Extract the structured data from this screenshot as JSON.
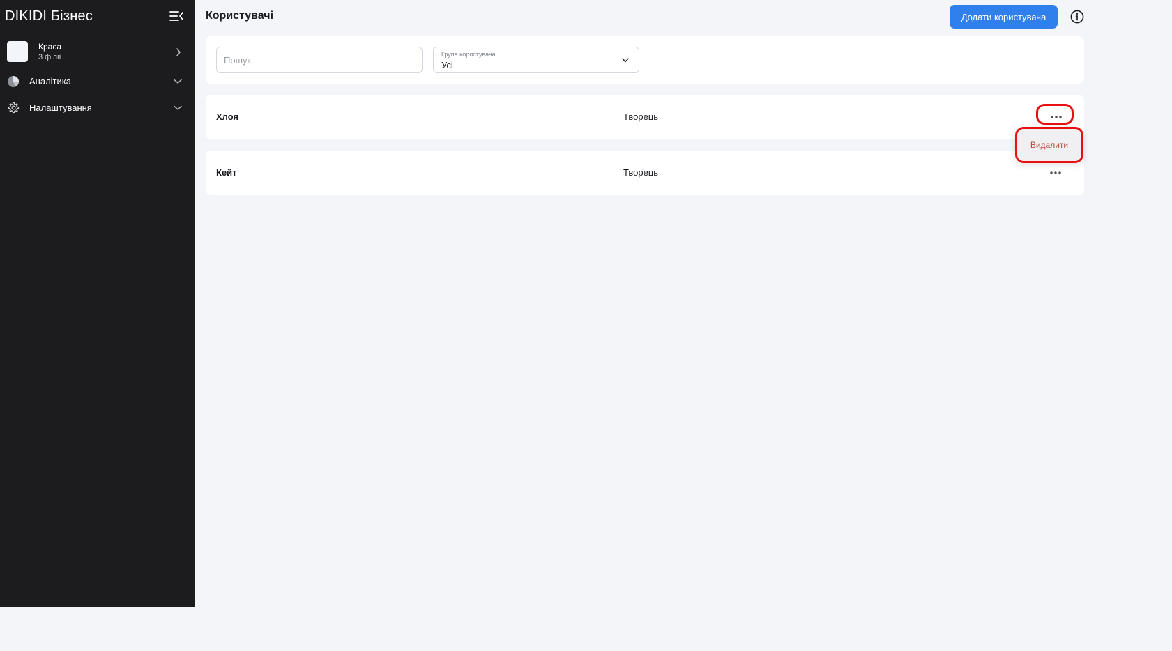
{
  "sidebar": {
    "brand": "DIKIDI Бізнес",
    "branch": {
      "name": "Краса",
      "subtitle": "3 філії"
    },
    "items": [
      {
        "label": "Аналітика",
        "icon": "pie-chart-icon"
      },
      {
        "label": "Налаштування",
        "icon": "gear-icon"
      }
    ]
  },
  "header": {
    "title": "Користувачі",
    "add_user_label": "Додати користувача"
  },
  "filters": {
    "search_placeholder": "Пошук",
    "search_value": "",
    "group_label": "Група користувача",
    "group_value": "Усі"
  },
  "users": [
    {
      "name": "Хлоя",
      "role": "Творець"
    },
    {
      "name": "Кейт",
      "role": "Творець"
    }
  ],
  "context_menu": {
    "delete_label": "Видалити"
  },
  "colors": {
    "sidebar_bg": "#1c1c1e",
    "accent": "#2f80ed",
    "page_bg": "#f3f5f9",
    "highlight": "#e81010",
    "delete_text": "#b84a3c"
  }
}
